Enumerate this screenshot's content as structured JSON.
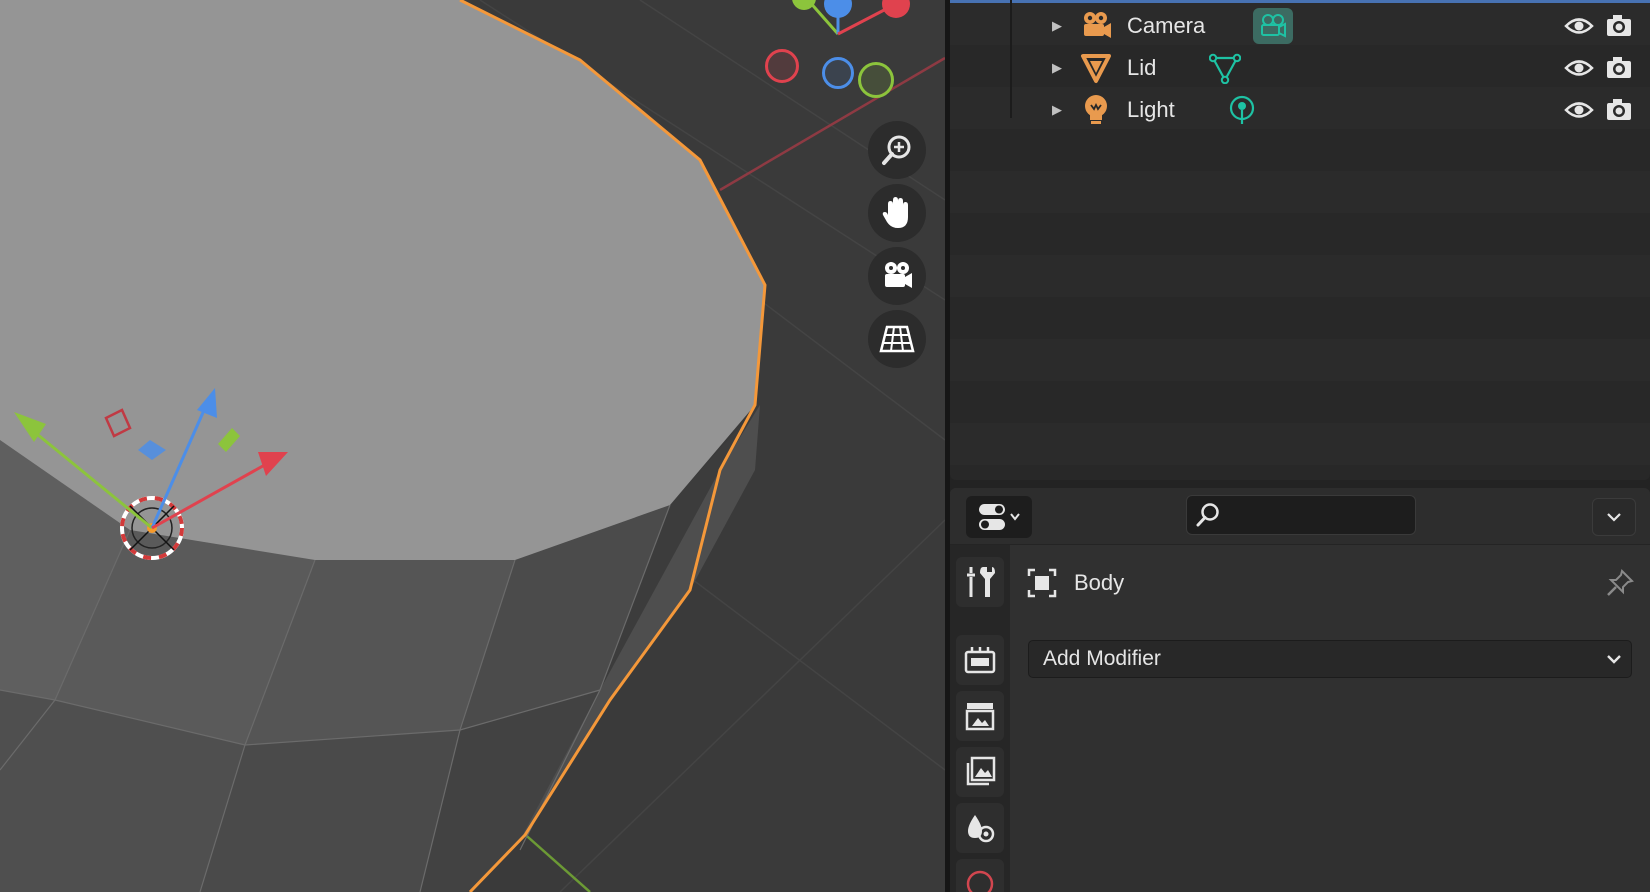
{
  "outliner": {
    "rows": [
      {
        "label": "Camera",
        "icon": "camera-object-icon",
        "data_icon": "camera-data-icon"
      },
      {
        "label": "Lid",
        "icon": "mesh-object-icon",
        "data_icon": "mesh-data-icon"
      },
      {
        "label": "Light",
        "icon": "light-object-icon",
        "data_icon": "light-data-icon"
      }
    ]
  },
  "properties": {
    "search": {
      "value": "",
      "placeholder": ""
    },
    "context_object": "Body",
    "add_modifier_label": "Add Modifier",
    "tabs": [
      "tool-tab",
      "render-tab",
      "output-tab",
      "view-layer-tab",
      "scene-tab",
      "world-tab"
    ]
  },
  "colors": {
    "selection_outline": "#f4983a",
    "object_icon": "#e99a4e",
    "data_icon": "#1ec2a4",
    "axis_x": "#e0424e",
    "axis_y": "#8cc43c",
    "axis_z": "#4c8ee8",
    "active_header": "#4772b3"
  }
}
